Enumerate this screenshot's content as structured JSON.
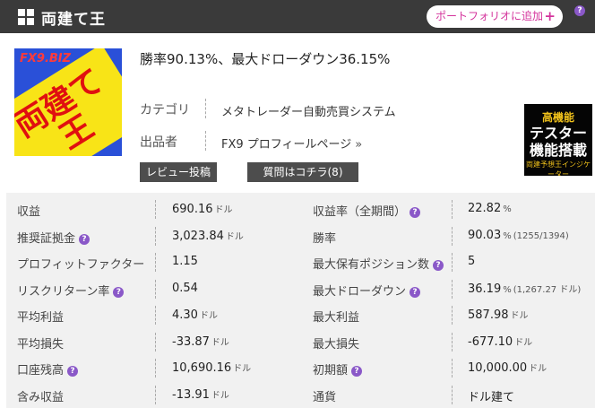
{
  "header": {
    "title": "両建て王",
    "portfolio_button": "ポートフォリオに追加",
    "portfolio_plus": "+",
    "help_mark": "?"
  },
  "thumbnail": {
    "brand": "FX9.BIZ",
    "line1": "両建て",
    "line2": "王"
  },
  "side_banner": {
    "line1": "高機能",
    "line2a": "テスター",
    "line2b": "機能搭載",
    "line3": "両建予想王インジケーター"
  },
  "summary": "勝率90.13%、最大ドローダウン36.15%",
  "meta": {
    "category_label": "カテゴリ",
    "category_value": "メタトレーダー自動売買システム",
    "seller_label": "出品者",
    "seller_value": "FX9 プロフィールページ",
    "seller_arrow": "»"
  },
  "buttons": {
    "review": "レビュー投稿",
    "question": "質問はコチラ(8)"
  },
  "stats": [
    {
      "l_label": "収益",
      "l_help": false,
      "l_value": "690.16",
      "l_unit": "ドル",
      "l_extra": "",
      "r_label": "収益率（全期間）",
      "r_help": true,
      "r_value": "22.82",
      "r_unit": "%",
      "r_extra": ""
    },
    {
      "l_label": "推奨証拠金",
      "l_help": true,
      "l_value": "3,023.84",
      "l_unit": "ドル",
      "l_extra": "",
      "r_label": "勝率",
      "r_help": false,
      "r_value": "90.03",
      "r_unit": "%",
      "r_extra": "(1255/1394)"
    },
    {
      "l_label": "プロフィットファクター",
      "l_help": false,
      "l_value": "1.15",
      "l_unit": "",
      "l_extra": "",
      "r_label": "最大保有ポジション数",
      "r_help": true,
      "r_value": "5",
      "r_unit": "",
      "r_extra": ""
    },
    {
      "l_label": "リスクリターン率",
      "l_help": true,
      "l_value": "0.54",
      "l_unit": "",
      "l_extra": "",
      "r_label": "最大ドローダウン",
      "r_help": true,
      "r_value": "36.19",
      "r_unit": "%",
      "r_extra": "(1,267.27 ドル)"
    },
    {
      "l_label": "平均利益",
      "l_help": false,
      "l_value": "4.30",
      "l_unit": "ドル",
      "l_extra": "",
      "r_label": "最大利益",
      "r_help": false,
      "r_value": "587.98",
      "r_unit": "ドル",
      "r_extra": ""
    },
    {
      "l_label": "平均損失",
      "l_help": false,
      "l_value": "-33.87",
      "l_unit": "ドル",
      "l_extra": "",
      "r_label": "最大損失",
      "r_help": false,
      "r_value": "-677.10",
      "r_unit": "ドル",
      "r_extra": ""
    },
    {
      "l_label": "口座残高",
      "l_help": true,
      "l_value": "10,690.16",
      "l_unit": "ドル",
      "l_extra": "",
      "r_label": "初期額",
      "r_help": true,
      "r_value": "10,000.00",
      "r_unit": "ドル",
      "r_extra": ""
    },
    {
      "l_label": "含み収益",
      "l_help": false,
      "l_value": "-13.91",
      "l_unit": "ドル",
      "l_extra": "",
      "r_label": "通貨",
      "r_help": false,
      "r_value": "ドル建て",
      "r_unit": "",
      "r_extra": ""
    }
  ],
  "colors": {
    "header_bg": "#3a3a3a",
    "accent_pink": "#d4349c",
    "help_purple": "#8a58c8",
    "table_bg": "#f1f1f1"
  }
}
